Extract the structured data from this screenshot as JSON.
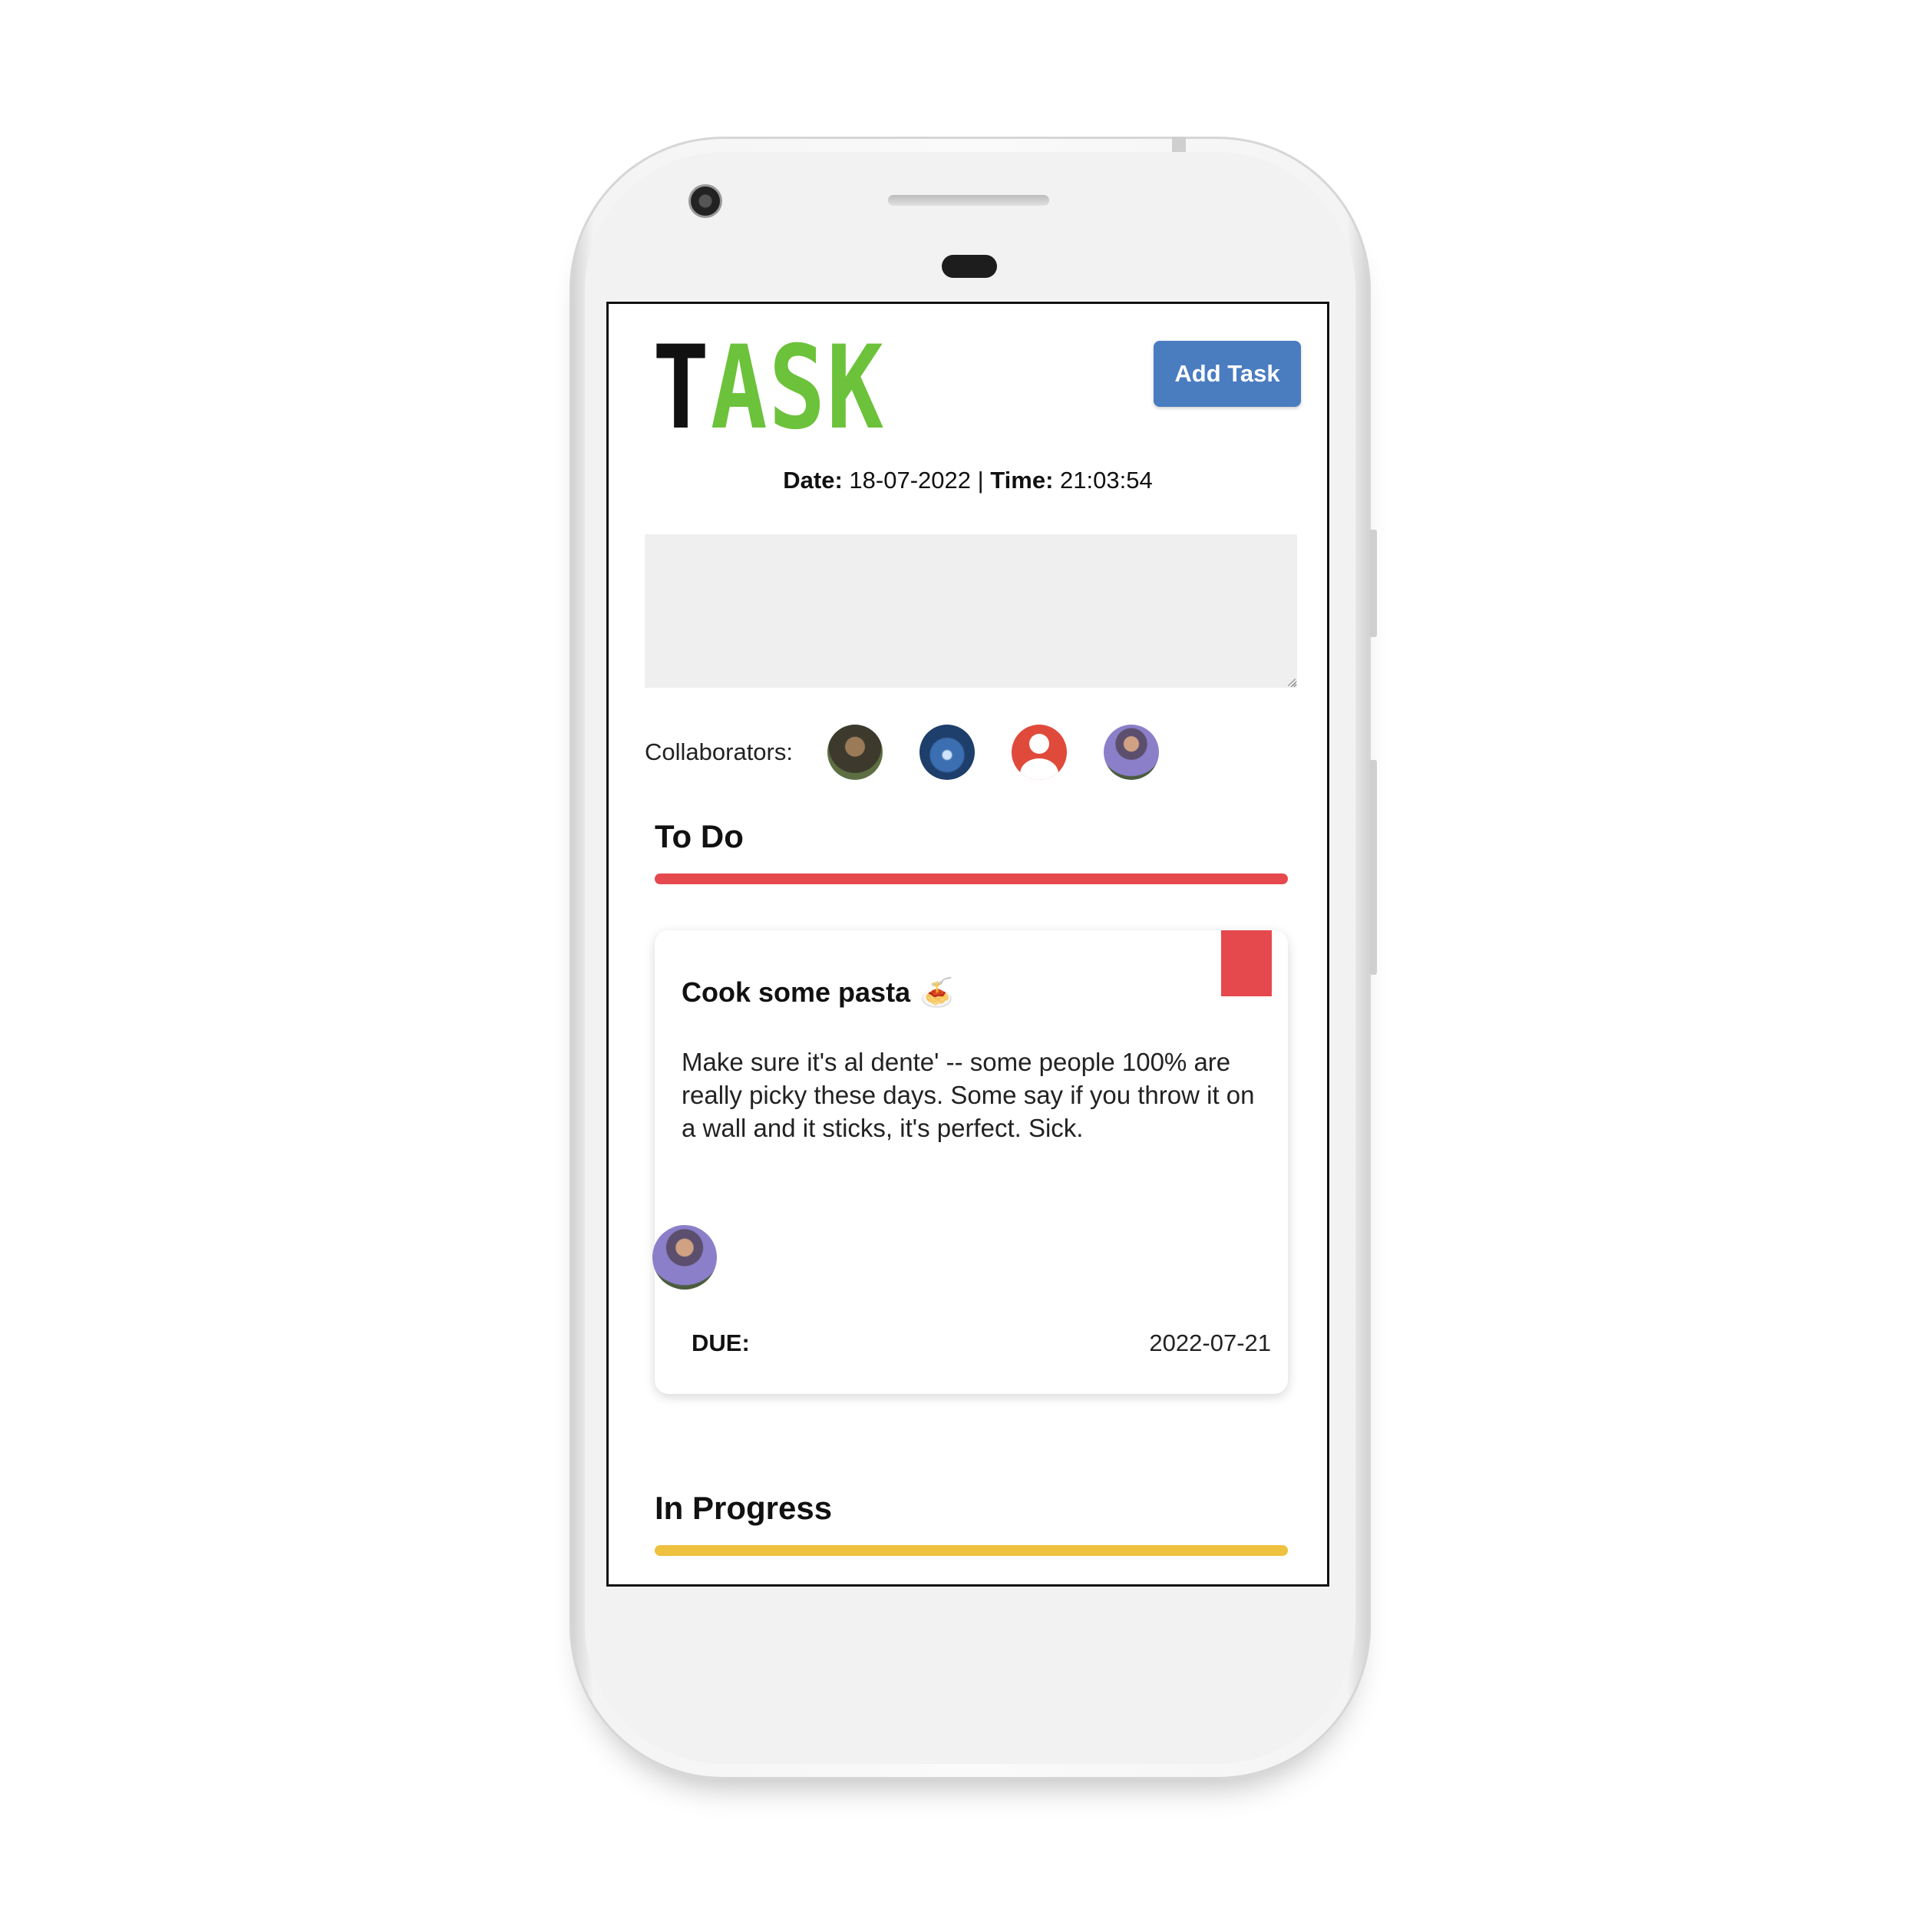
{
  "app": {
    "logo_first": "T",
    "logo_rest": "ASK",
    "add_task_label": "Add Task"
  },
  "datetime": {
    "date_label": "Date:",
    "date_value": "18-07-2022",
    "separator": "|",
    "time_label": "Time:",
    "time_value": "21:03:54"
  },
  "collaborators": {
    "label": "Collaborators:",
    "count": 4
  },
  "columns": {
    "todo": {
      "title": "To Do",
      "color": "#e5484d"
    },
    "in_progress": {
      "title": "In Progress",
      "color": "#eec13f"
    }
  },
  "task": {
    "title": "Cook some pasta",
    "emoji": "🍝",
    "description": "Make sure it's al dente' -- some people 100% are really picky these days. Some say if you throw it on a wall and it sticks, it's perfect. Sick.",
    "due_label": "DUE:",
    "due_date": "2022-07-21",
    "priority_color": "#e5484d"
  },
  "colors": {
    "accent_green": "#6cc23a",
    "button_blue": "#4a7cc0"
  }
}
